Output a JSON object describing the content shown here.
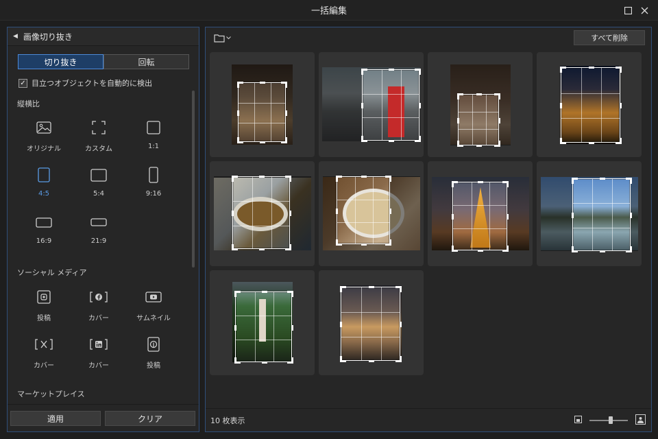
{
  "window": {
    "title": "一括編集"
  },
  "left_panel": {
    "header": "画像切り抜き",
    "tabs": [
      {
        "label": "切り抜き",
        "active": true
      },
      {
        "label": "回転",
        "active": false
      }
    ],
    "auto_detect": {
      "label": "目立つオブジェクトを自動的に検出",
      "checked": true
    },
    "aspect_section": "縦横比",
    "aspect_items": [
      {
        "label": "オリジナル",
        "icon": "original-image-icon"
      },
      {
        "label": "カスタム",
        "icon": "custom-crop-icon"
      },
      {
        "label": "1:1",
        "icon": "ratio-1-1-icon"
      },
      {
        "label": "4:5",
        "icon": "ratio-4-5-icon",
        "active": true
      },
      {
        "label": "5:4",
        "icon": "ratio-5-4-icon"
      },
      {
        "label": "9:16",
        "icon": "ratio-9-16-icon"
      },
      {
        "label": "16:9",
        "icon": "ratio-16-9-icon"
      },
      {
        "label": "21:9",
        "icon": "ratio-21-9-icon"
      }
    ],
    "social_section": "ソーシャル メディア",
    "social_items": [
      {
        "label": "投稿",
        "icon": "instagram-post-icon"
      },
      {
        "label": "カバー",
        "icon": "facebook-cover-icon"
      },
      {
        "label": "サムネイル",
        "icon": "youtube-thumbnail-icon"
      },
      {
        "label": "カバー",
        "icon": "x-cover-icon"
      },
      {
        "label": "カバー",
        "icon": "linkedin-cover-icon"
      },
      {
        "label": "投稿",
        "icon": "pinterest-post-icon"
      }
    ],
    "market_section": "マーケットプレイス",
    "apply_label": "適用",
    "clear_label": "クリア"
  },
  "right_panel": {
    "delete_all_label": "すべて削除",
    "status_count": "10 枚表示"
  },
  "colors": {
    "accent": "#4d8ad8",
    "panel_border": "#2f4e7a",
    "background": "#1e1e1e"
  }
}
